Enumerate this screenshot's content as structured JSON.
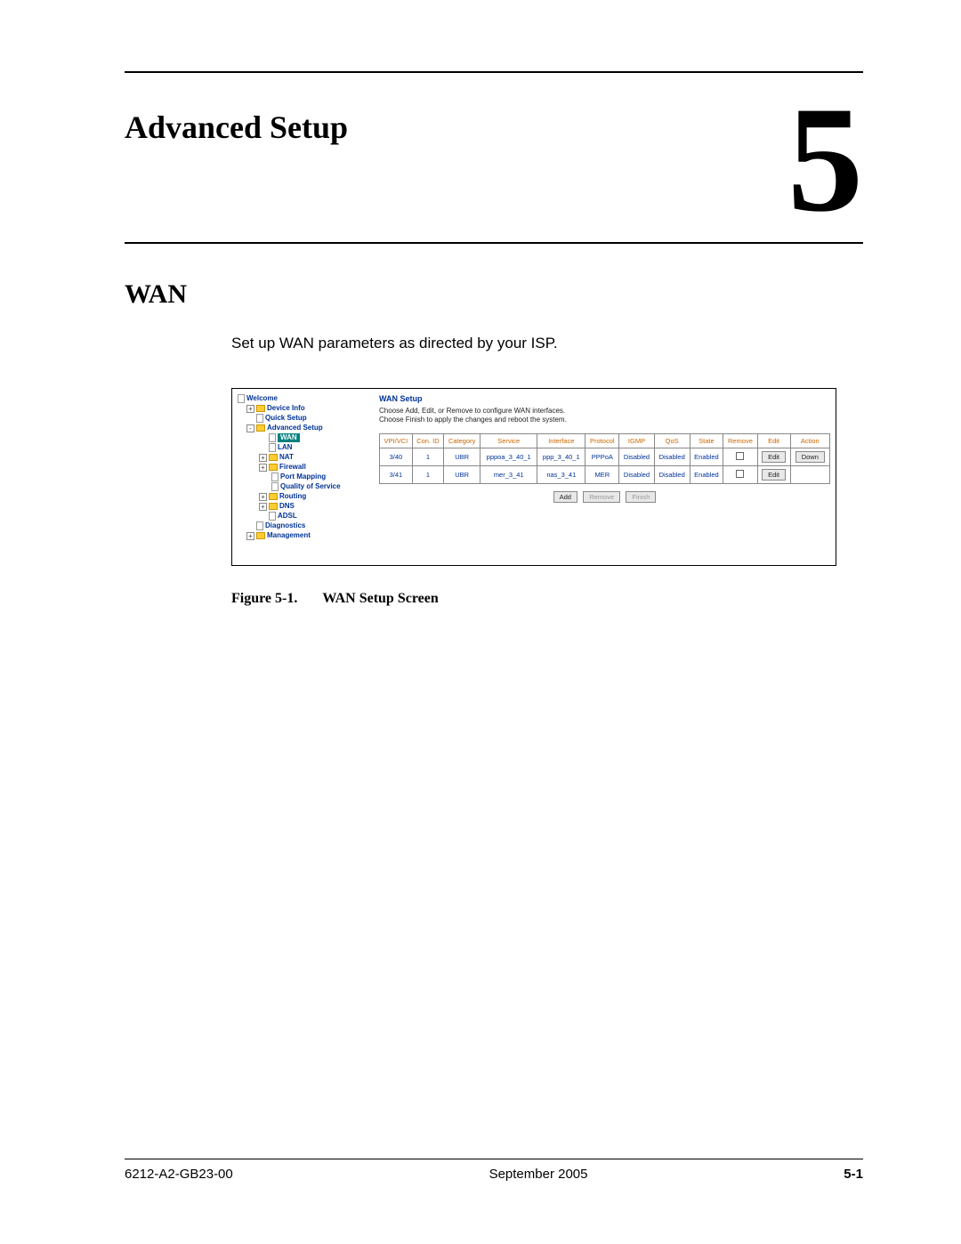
{
  "chapter": {
    "title": "Advanced Setup",
    "number": "5"
  },
  "section": {
    "title": "WAN",
    "body": "Set up WAN parameters as directed by your ISP."
  },
  "nav": {
    "welcome": "Welcome",
    "device_info": "Device Info",
    "quick_setup": "Quick Setup",
    "advanced_setup": "Advanced Setup",
    "wan": "WAN",
    "lan": "LAN",
    "nat": "NAT",
    "firewall": "Firewall",
    "port_mapping": "Port Mapping",
    "qos": "Quality of Service",
    "routing": "Routing",
    "dns": "DNS",
    "adsl": "ADSL",
    "diagnostics": "Diagnostics",
    "management": "Management"
  },
  "wan_panel": {
    "title": "WAN Setup",
    "desc1": "Choose Add, Edit, or Remove to configure WAN interfaces.",
    "desc2": "Choose Finish to apply the changes and reboot the system.",
    "headers": [
      "VPI/VCI",
      "Con. ID",
      "Category",
      "Service",
      "Interface",
      "Protocol",
      "IGMP",
      "QoS",
      "State",
      "Remove",
      "Edit",
      "Action"
    ],
    "rows": [
      {
        "vpi": "3/40",
        "con": "1",
        "cat": "UBR",
        "svc": "pppoa_3_40_1",
        "iface": "ppp_3_40_1",
        "proto": "PPPoA",
        "igmp": "Disabled",
        "qos": "Disabled",
        "state": "Enabled",
        "edit": "Edit",
        "action": "Down"
      },
      {
        "vpi": "3/41",
        "con": "1",
        "cat": "UBR",
        "svc": "mer_3_41",
        "iface": "nas_3_41",
        "proto": "MER",
        "igmp": "Disabled",
        "qos": "Disabled",
        "state": "Enabled",
        "edit": "Edit",
        "action": ""
      }
    ],
    "buttons": {
      "add": "Add",
      "remove": "Remove",
      "finish": "Finish"
    }
  },
  "figure": {
    "num": "Figure 5-1.",
    "caption": "WAN Setup Screen"
  },
  "footer": {
    "docnum": "6212-A2-GB23-00",
    "date": "September 2005",
    "page": "5-1"
  }
}
